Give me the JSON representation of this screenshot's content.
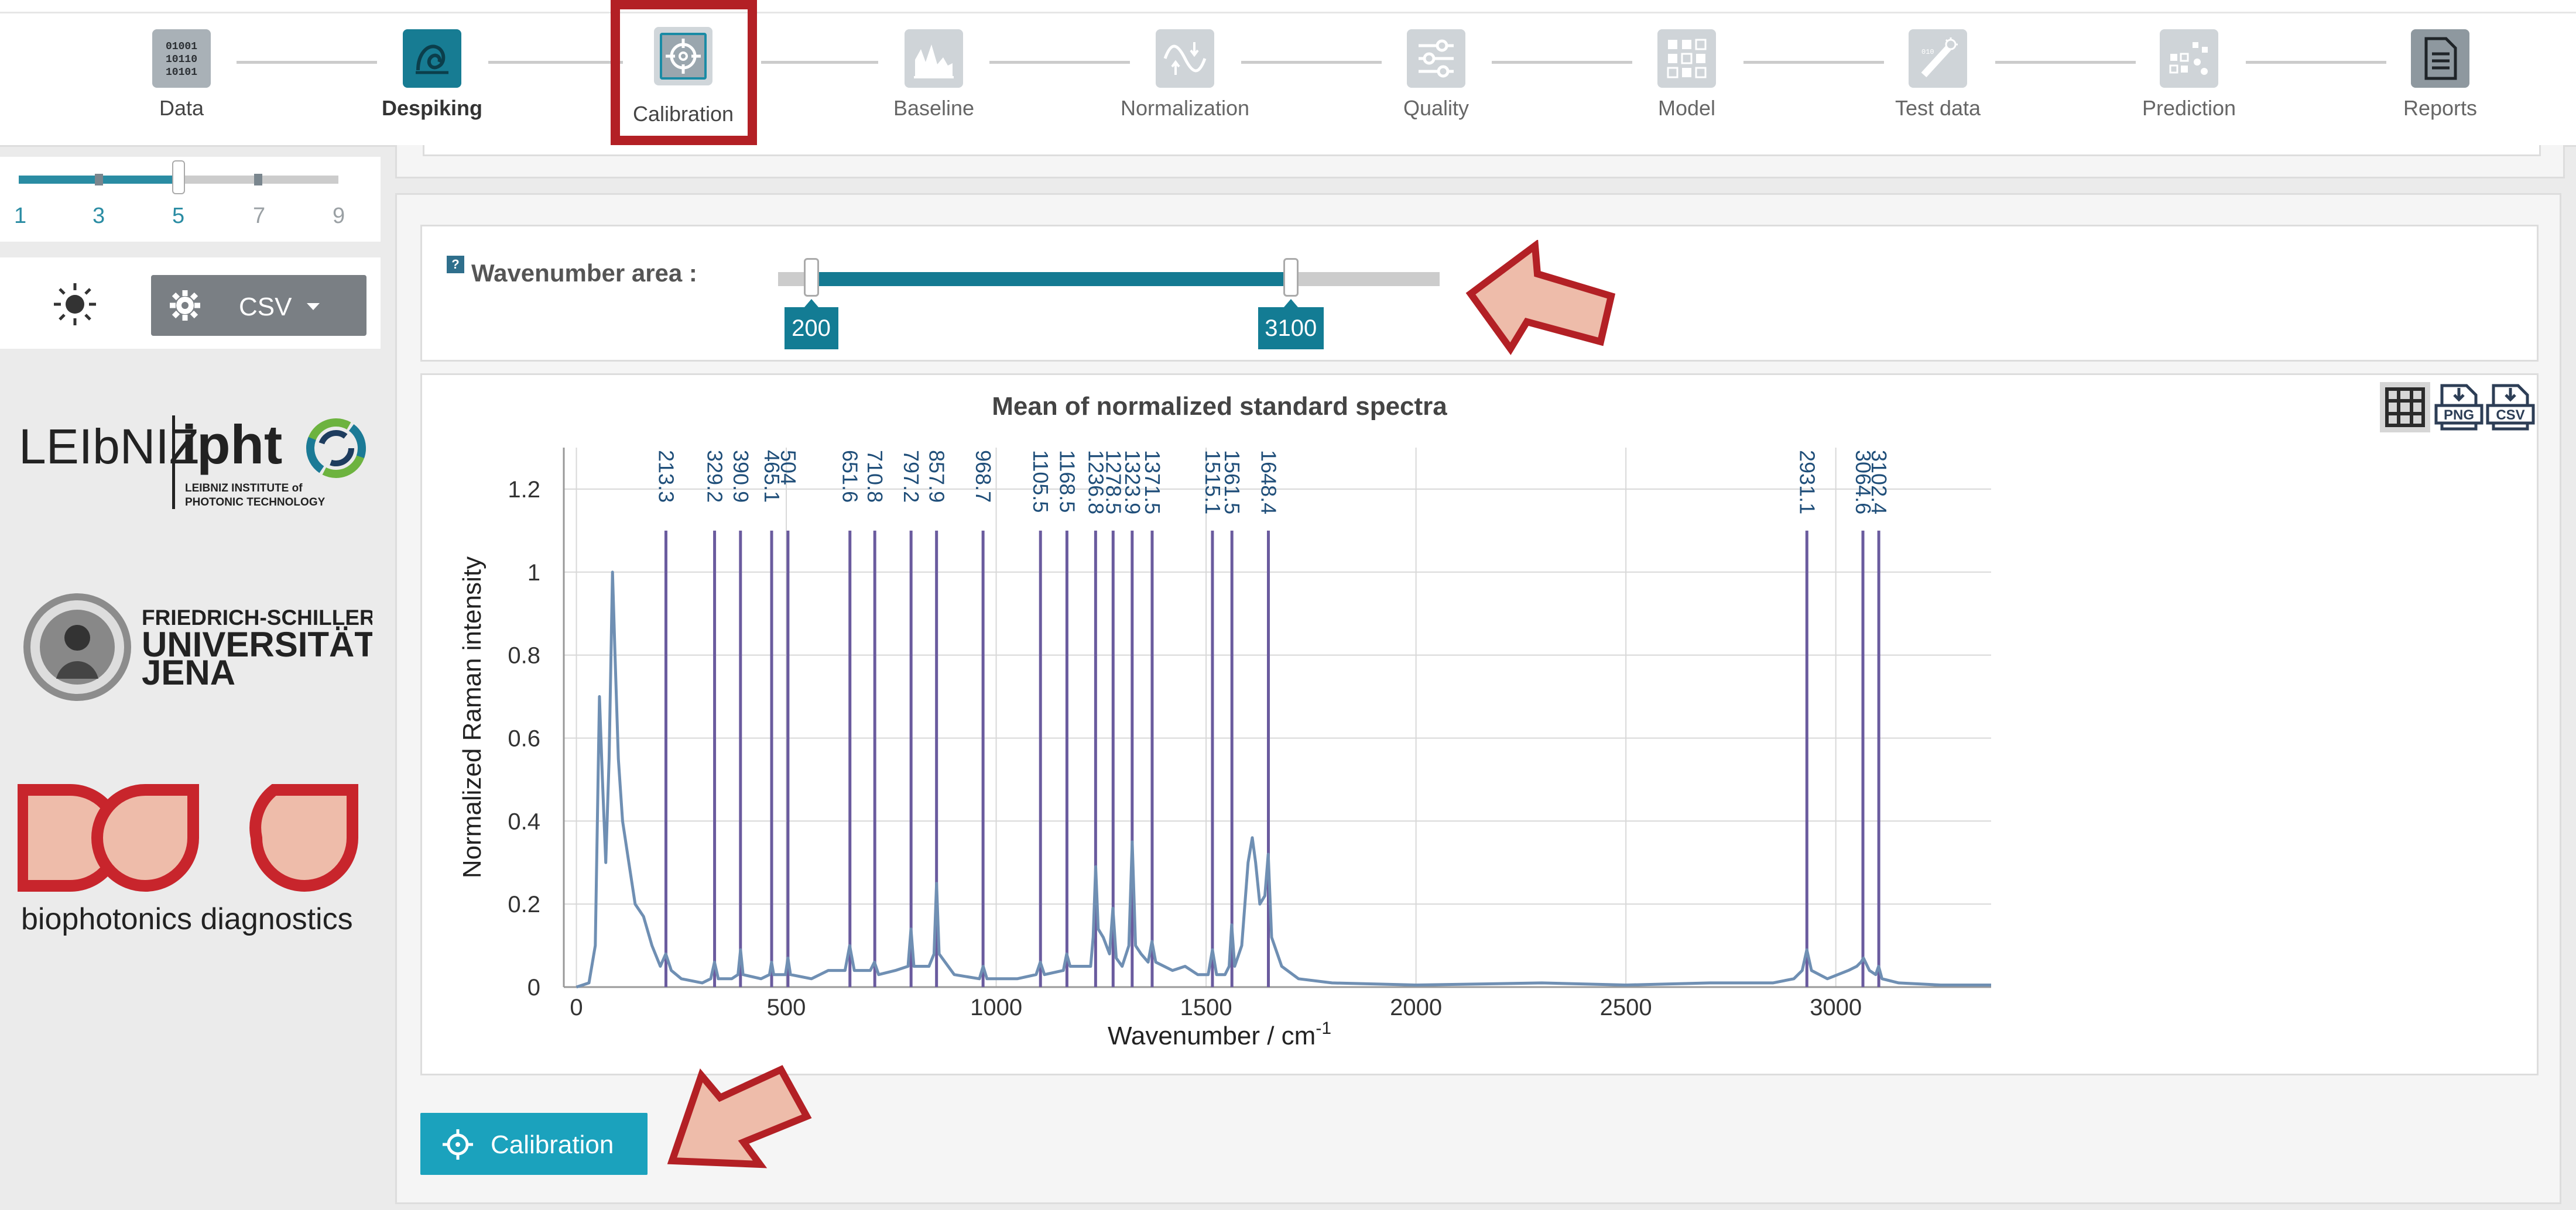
{
  "workflow": {
    "steps": [
      {
        "label": "Data",
        "icon": "binary-data-icon"
      },
      {
        "label": "Despiking",
        "icon": "despike-icon"
      },
      {
        "label": "Calibration",
        "icon": "calibration-target-icon"
      },
      {
        "label": "Baseline",
        "icon": "baseline-icon"
      },
      {
        "label": "Normalization",
        "icon": "normalization-icon"
      },
      {
        "label": "Quality",
        "icon": "quality-sliders-icon"
      },
      {
        "label": "Model",
        "icon": "model-grid-icon"
      },
      {
        "label": "Test data",
        "icon": "test-data-icon"
      },
      {
        "label": "Prediction",
        "icon": "prediction-icon"
      },
      {
        "label": "Reports",
        "icon": "reports-document-icon"
      }
    ],
    "active_step": "Calibration",
    "highlight_color": "#b32025"
  },
  "sidebar": {
    "level_slider": {
      "ticks": [
        "1",
        "3",
        "5",
        "7",
        "9"
      ],
      "value": "5"
    },
    "tools": {
      "theme_icon": "sun-icon",
      "settings_icon": "gear-icon",
      "export_label": "CSV"
    },
    "logos": {
      "leibniz": {
        "word1": "LEIbNIZ",
        "word2": "ipht",
        "line1": "LEIBNIZ INSTITUTE of",
        "line2": "PHOTONIC TECHNOLOGY"
      },
      "jena": {
        "line1": "FRIEDRICH-SCHILLER-",
        "line2": "UNIVERSITÄT",
        "line3": "JENA"
      },
      "biophotonics": {
        "text": "biophotonics diagnostics"
      }
    }
  },
  "wavenumber_area": {
    "help_label": "?",
    "label": "Wavenumber area :",
    "min": 0,
    "max": 4000,
    "low": 200,
    "high": 3100,
    "low_label": "200",
    "high_label": "3100"
  },
  "chart_tools": {
    "table_icon": "table-grid-icon",
    "png_icon": "png-download-icon",
    "csv_icon": "csv-download-icon",
    "png_label": "PNG",
    "csv_label": "CSV"
  },
  "chart_data": {
    "type": "line",
    "title": "Mean of normalized standard spectra",
    "xlabel": "Wavenumber / cm",
    "xlabel_sup": "-1",
    "ylabel": "Normalized Raman intensity",
    "xlim": [
      -30,
      3370
    ],
    "ylim": [
      0,
      1.3
    ],
    "xticks": [
      0,
      500,
      1000,
      1500,
      2000,
      2500,
      3000
    ],
    "yticks": [
      0,
      0.2,
      0.4,
      0.6,
      0.8,
      1,
      1.2
    ],
    "grid": true,
    "calibration_peaks": [
      {
        "x": 213.3,
        "label": "213.3"
      },
      {
        "x": 329.2,
        "label": "329.2"
      },
      {
        "x": 390.9,
        "label": "390.9"
      },
      {
        "x": 465.1,
        "label": "465.1"
      },
      {
        "x": 504,
        "label": "504"
      },
      {
        "x": 651.6,
        "label": "651.6"
      },
      {
        "x": 710.8,
        "label": "710.8"
      },
      {
        "x": 797.2,
        "label": "797.2"
      },
      {
        "x": 857.9,
        "label": "857.9"
      },
      {
        "x": 968.7,
        "label": "968.7"
      },
      {
        "x": 1105.5,
        "label": "1105.5"
      },
      {
        "x": 1168.5,
        "label": "1168.5"
      },
      {
        "x": 1236.8,
        "label": "1236.8"
      },
      {
        "x": 1278.5,
        "label": "1278.5"
      },
      {
        "x": 1323.9,
        "label": "1323.9"
      },
      {
        "x": 1371.5,
        "label": "1371.5"
      },
      {
        "x": 1515.1,
        "label": "1515.1"
      },
      {
        "x": 1561.5,
        "label": "1561.5"
      },
      {
        "x": 1648.4,
        "label": "1648.4"
      },
      {
        "x": 2931.1,
        "label": "2931.1"
      },
      {
        "x": 3064.6,
        "label": "3064.6"
      },
      {
        "x": 3102.4,
        "label": "3102.4"
      }
    ],
    "peak_line_value": 1.1,
    "peak_line_color": "#6a5b9e",
    "spectrum_color": "#6f8fb3",
    "series": [
      {
        "x": [
          0,
          30,
          45,
          55,
          62,
          70,
          78,
          86,
          92,
          100,
          110,
          125,
          140,
          160,
          180,
          200,
          213,
          226,
          250,
          300,
          320,
          329,
          338,
          370,
          385,
          391,
          397,
          440,
          460,
          465,
          470,
          498,
          504,
          510,
          560,
          600,
          640,
          651,
          662,
          700,
          710,
          720,
          760,
          790,
          797,
          804,
          840,
          852,
          858,
          864,
          900,
          960,
          969,
          978,
          1050,
          1095,
          1105,
          1115,
          1160,
          1168,
          1176,
          1225,
          1231,
          1237,
          1243,
          1255,
          1270,
          1278,
          1286,
          1300,
          1316,
          1324,
          1332,
          1345,
          1362,
          1371,
          1380,
          1420,
          1450,
          1480,
          1505,
          1515,
          1525,
          1545,
          1555,
          1561,
          1568,
          1585,
          1600,
          1610,
          1618,
          1628,
          1640,
          1648,
          1656,
          1680,
          1720,
          1800,
          2000,
          2300,
          2500,
          2700,
          2850,
          2900,
          2920,
          2931,
          2942,
          2980,
          3030,
          3050,
          3060,
          3066,
          3080,
          3095,
          3102,
          3110,
          3150,
          3250,
          3370
        ],
        "y": [
          0,
          0.01,
          0.1,
          0.7,
          0.5,
          0.3,
          0.55,
          1.0,
          0.8,
          0.55,
          0.4,
          0.3,
          0.2,
          0.17,
          0.1,
          0.05,
          0.08,
          0.04,
          0.02,
          0.01,
          0.02,
          0.06,
          0.02,
          0.02,
          0.03,
          0.09,
          0.03,
          0.02,
          0.03,
          0.06,
          0.03,
          0.03,
          0.07,
          0.03,
          0.02,
          0.04,
          0.04,
          0.1,
          0.04,
          0.04,
          0.06,
          0.03,
          0.04,
          0.05,
          0.14,
          0.05,
          0.05,
          0.08,
          0.25,
          0.08,
          0.03,
          0.02,
          0.05,
          0.02,
          0.02,
          0.03,
          0.06,
          0.03,
          0.04,
          0.08,
          0.05,
          0.05,
          0.12,
          0.29,
          0.14,
          0.12,
          0.08,
          0.19,
          0.07,
          0.05,
          0.1,
          0.35,
          0.1,
          0.08,
          0.06,
          0.11,
          0.06,
          0.04,
          0.05,
          0.03,
          0.03,
          0.09,
          0.03,
          0.03,
          0.05,
          0.15,
          0.05,
          0.1,
          0.3,
          0.36,
          0.3,
          0.2,
          0.22,
          0.32,
          0.12,
          0.05,
          0.02,
          0.01,
          0.005,
          0.01,
          0.005,
          0.01,
          0.01,
          0.02,
          0.04,
          0.09,
          0.04,
          0.02,
          0.04,
          0.05,
          0.06,
          0.07,
          0.04,
          0.03,
          0.05,
          0.02,
          0.01,
          0.005,
          0.005
        ]
      }
    ]
  },
  "actions": {
    "calibrate_label": "Calibration",
    "calibrate_icon": "crosshair-target-icon"
  },
  "annotations": {
    "arrow_fill": "#eebcaa",
    "arrow_stroke": "#b32025"
  }
}
